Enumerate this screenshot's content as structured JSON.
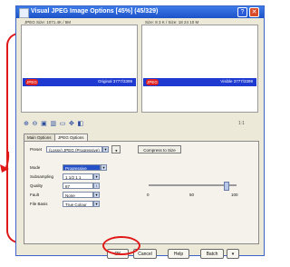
{
  "window": {
    "title": "Visual JPEG Image Options [45%] (45/329)",
    "help_glyph": "?",
    "close_glyph": "✕"
  },
  "previews": {
    "left": {
      "header": "JPEG Size: 1071.4K / 5M",
      "badge": "JPEG",
      "status": "Original  3777/3399"
    },
    "right": {
      "header": "Size: 8 3 K / Size: 18 24 10 M",
      "badge": "JPEG",
      "status": "Visible  3777/3399"
    }
  },
  "toolbar": {
    "zoom_label": "1:1"
  },
  "tabs": [
    "Main Options",
    "JPEG Options"
  ],
  "options": {
    "preset_label": "Preset",
    "preset_value": "(Lossy) JPEG (Progressive)",
    "compress_button": "Compress to Size",
    "rows": [
      {
        "label": "Mode",
        "value": "Progressive"
      },
      {
        "label": "Subsampling",
        "value": "1 1/2 1 1"
      },
      {
        "label": "Quality",
        "value": "87"
      },
      {
        "label": "Fault",
        "value": "None"
      },
      {
        "label": "File Basis",
        "value": "True Colour"
      }
    ],
    "slider_ticks": [
      "0",
      "50",
      "100"
    ]
  },
  "buttons": {
    "ok": "OK",
    "cancel": "Cancel",
    "help": "Help",
    "batch": "Batch"
  },
  "colors": {
    "annotation": "#e01818",
    "selection": "#1e3ad0"
  }
}
